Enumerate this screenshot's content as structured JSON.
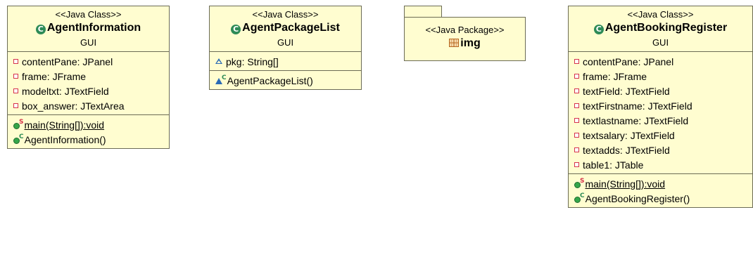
{
  "classes": [
    {
      "stereotype": "<<Java Class>>",
      "name": "AgentInformation",
      "package": "GUI",
      "fields": [
        "contentPane: JPanel",
        "frame: JFrame",
        "modeltxt: JTextField",
        "box_answer: JTextArea"
      ],
      "methods": [
        "main(String[]):void",
        "AgentInformation()"
      ]
    },
    {
      "stereotype": "<<Java Class>>",
      "name": "AgentPackageList",
      "package": "GUI",
      "fields": [
        "pkg: String[]"
      ],
      "methods": [
        "AgentPackageList()"
      ]
    },
    {
      "stereotype": "<<Java Class>>",
      "name": "AgentBookingRegister",
      "package": "GUI",
      "fields": [
        "contentPane: JPanel",
        "frame: JFrame",
        "textField: JTextField",
        "textFirstname: JTextField",
        "textlastname: JTextField",
        "textsalary: JTextField",
        "textadds: JTextField",
        "table1: JTable"
      ],
      "methods": [
        "main(String[]):void",
        "AgentBookingRegister()"
      ]
    }
  ],
  "java_package": {
    "stereotype": "<<Java Package>>",
    "name": "img"
  },
  "icons": {
    "class": "class-c-icon",
    "private_field": "private-field-icon",
    "package_field": "package-field-icon",
    "static_method": "public-static-method-icon",
    "constructor": "constructor-icon",
    "package": "package-grid-icon"
  },
  "colors": {
    "box_fill": "#fffdd0",
    "box_border": "#6b6b55",
    "class_icon": "#2e8b57",
    "private_icon": "#d6334b",
    "package_icon": "#2a6bb5",
    "method_icon": "#35a64a"
  }
}
